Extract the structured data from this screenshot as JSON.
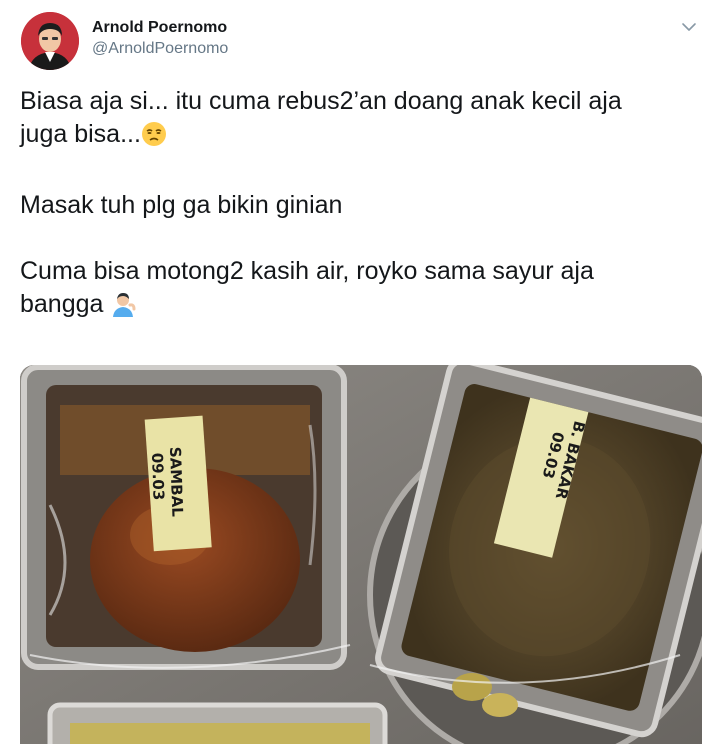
{
  "author": {
    "display_name": "Arnold Poernomo",
    "handle": "@ArnoldPoernomo"
  },
  "menu": {
    "icon": "chevron-down-icon"
  },
  "tweet": {
    "line1": "Biasa aja si... itu cuma rebus2’an doang anak kecil aja",
    "line2": "juga bisa...",
    "line3": "Masak tuh plg ga bikin ginian",
    "line4": "Cuma bisa motong2 kasih air, royko sama sayur aja",
    "line5": "bangga",
    "emoji1": "unamused-face-emoji",
    "emoji2": "person-tipping-hand-emoji"
  },
  "media": {
    "label_left_name": "SAMBAL",
    "label_left_date": "09.03",
    "label_right_name": "B. BAKAR",
    "label_right_date": "09.03"
  },
  "colors": {
    "avatar_bg": "#c7313b",
    "handle": "#657786",
    "text": "#14171a"
  }
}
